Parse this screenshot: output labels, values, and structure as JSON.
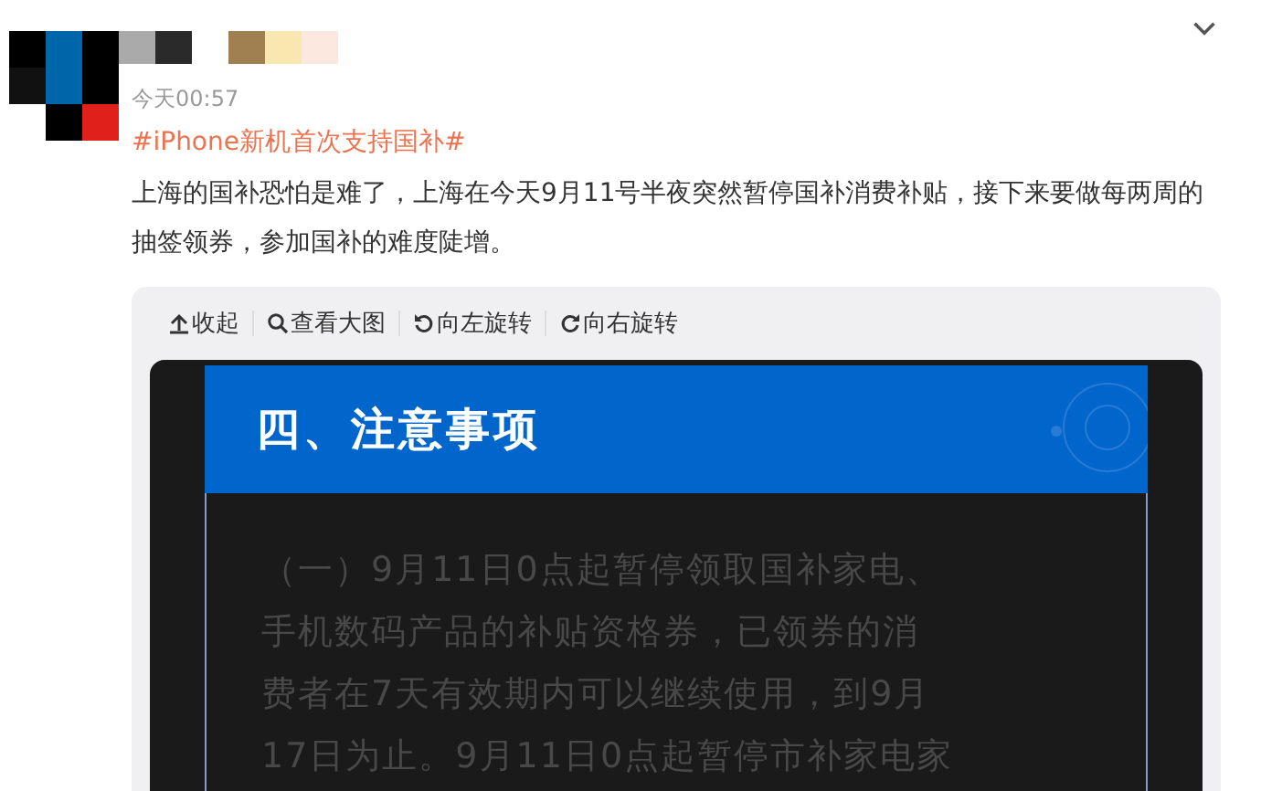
{
  "post": {
    "time": "今天00:57",
    "hashtag": "#iPhone新机首次支持国补#",
    "text": "上海的国补恐怕是难了，上海在今天9月11号半夜突然暂停国补消费补贴，接下来要做每两周的抽签领券，参加国补的难度陡增。"
  },
  "viewer": {
    "toolbar": [
      {
        "kind": "collapse",
        "label": "收起"
      },
      {
        "kind": "zoom",
        "label": "查看大图"
      },
      {
        "kind": "rotate-left",
        "label": "向左旋转"
      },
      {
        "kind": "rotate-right",
        "label": "向右旋转"
      }
    ],
    "image": {
      "heading": "四、注意事项",
      "lines": [
        "（一）9月11日0点起暂停领取国补家电、",
        "手机数码产品的补贴资格券，已领券的消",
        "费者在7天有效期内可以继续使用，到9月",
        "17日为止。9月11日0点起暂停市补家电家"
      ]
    }
  }
}
